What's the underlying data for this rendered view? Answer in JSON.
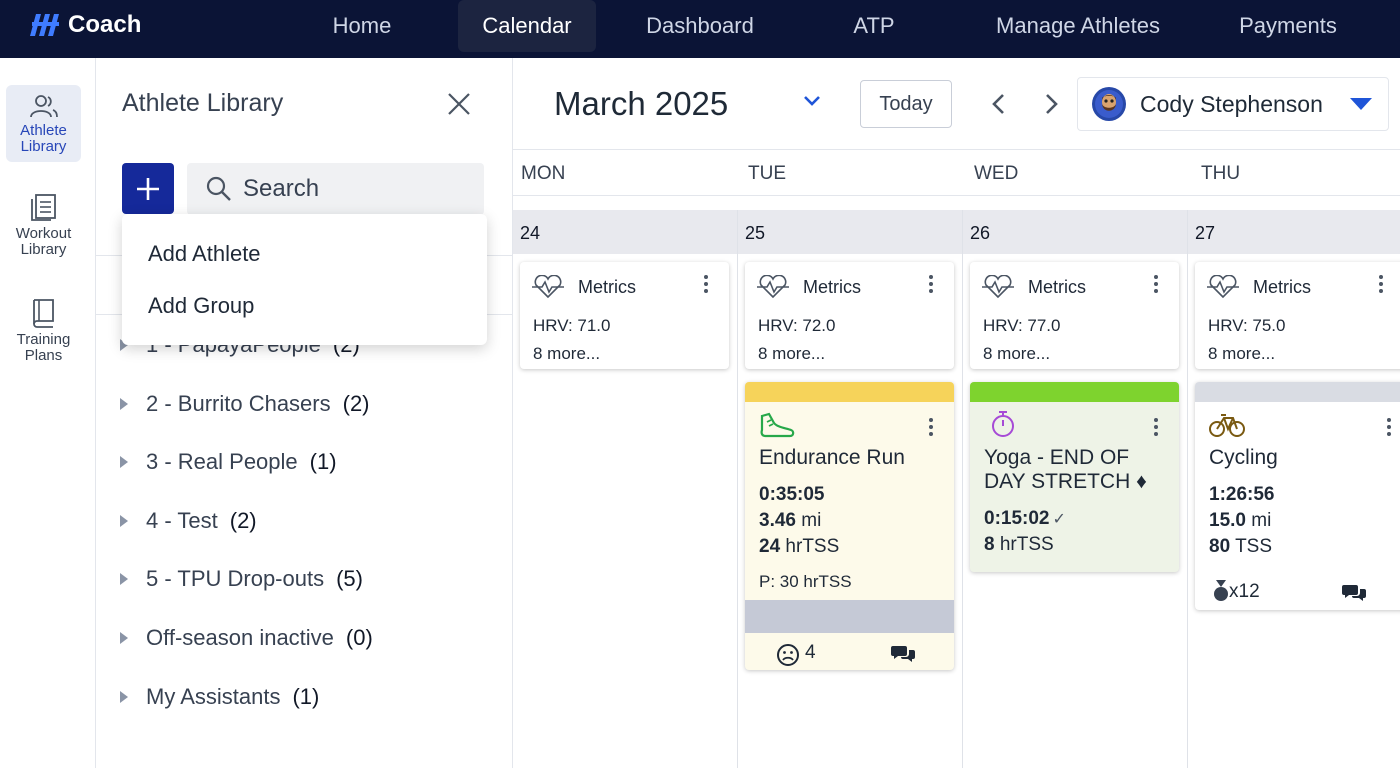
{
  "app": {
    "name": "Coach"
  },
  "nav": {
    "items": [
      {
        "label": "Home"
      },
      {
        "label": "Calendar"
      },
      {
        "label": "Dashboard"
      },
      {
        "label": "ATP"
      },
      {
        "label": "Manage Athletes"
      },
      {
        "label": "Payments"
      }
    ],
    "active": "Calendar"
  },
  "rail": {
    "items": [
      {
        "label_line1": "Athlete",
        "label_line2": "Library"
      },
      {
        "label_line1": "Workout",
        "label_line2": "Library"
      },
      {
        "label_line1": "Training",
        "label_line2": "Plans"
      }
    ]
  },
  "library": {
    "title": "Athlete Library",
    "search_placeholder": "Search",
    "dropdown": [
      "Add Athlete",
      "Add Group"
    ],
    "groups": [
      {
        "name": "1 - PapayaPeople",
        "count": "(2)"
      },
      {
        "name": "2 - Burrito Chasers",
        "count": "(2)"
      },
      {
        "name": "3 - Real People",
        "count": "(1)"
      },
      {
        "name": "4 - Test",
        "count": "(2)"
      },
      {
        "name": "5 - TPU Drop-outs",
        "count": "(5)"
      },
      {
        "name": "Off-season inactive",
        "count": "(0)"
      },
      {
        "name": "My Assistants",
        "count": "(1)"
      }
    ]
  },
  "calendar": {
    "month": "March 2025",
    "today_label": "Today",
    "athlete_name": "Cody Stephenson",
    "days": [
      {
        "dow": "MON",
        "date": "24",
        "metrics": {
          "title": "Metrics",
          "hrv": "HRV: 71.0",
          "more": "8 more..."
        }
      },
      {
        "dow": "TUE",
        "date": "25",
        "metrics": {
          "title": "Metrics",
          "hrv": "HRV: 72.0",
          "more": "8 more..."
        }
      },
      {
        "dow": "WED",
        "date": "26",
        "metrics": {
          "title": "Metrics",
          "hrv": "HRV: 77.0",
          "more": "8 more..."
        }
      },
      {
        "dow": "THU",
        "date": "27",
        "metrics": {
          "title": "Metrics",
          "hrv": "HRV: 75.0",
          "more": "8 more..."
        }
      }
    ],
    "workouts": {
      "run": {
        "title": "Endurance Run",
        "duration": "0:35:05",
        "distance_value": "3.46",
        "distance_unit": " mi",
        "tss_value": "24",
        "tss_unit": " hrTSS",
        "planned": "P: 30 hrTSS",
        "feeling_count": "4",
        "strip_color": "#f6d35a"
      },
      "yoga": {
        "title_line1": "Yoga - END OF",
        "title_line2": "DAY STRETCH ♦",
        "duration": "0:15:02",
        "check": "✓",
        "tss_value": "8",
        "tss_unit": " hrTSS",
        "strip_color": "#7ed32e"
      },
      "cycling": {
        "title": "Cycling",
        "duration": "1:26:56",
        "distance_value": "15.0",
        "distance_unit": " mi",
        "tss_value": "80",
        "tss_unit": " TSS",
        "medals": "x12",
        "strip_color": "#d9dce3"
      }
    }
  }
}
